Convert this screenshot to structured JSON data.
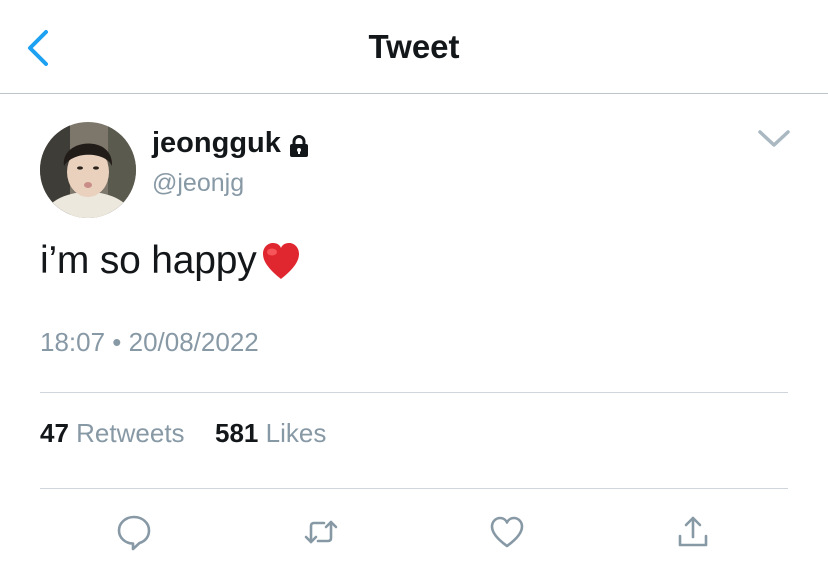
{
  "header": {
    "title": "Tweet",
    "back_icon": "chevron-left-icon",
    "accent_color": "#1da1f2"
  },
  "tweet": {
    "author": {
      "display_name": "jeongguk",
      "handle": "@jeonjg",
      "protected_icon": "lock-icon"
    },
    "text": "i’m so happy",
    "emoji": "red-heart",
    "timestamp": "18:07 • 20/08/2022",
    "stats": {
      "retweets_count": "47",
      "retweets_label": "Retweets",
      "likes_count": "581",
      "likes_label": "Likes"
    }
  },
  "actions": [
    {
      "name": "reply",
      "icon": "comment-icon"
    },
    {
      "name": "retweet",
      "icon": "retweet-icon"
    },
    {
      "name": "like",
      "icon": "heart-icon"
    },
    {
      "name": "share",
      "icon": "share-icon"
    }
  ]
}
